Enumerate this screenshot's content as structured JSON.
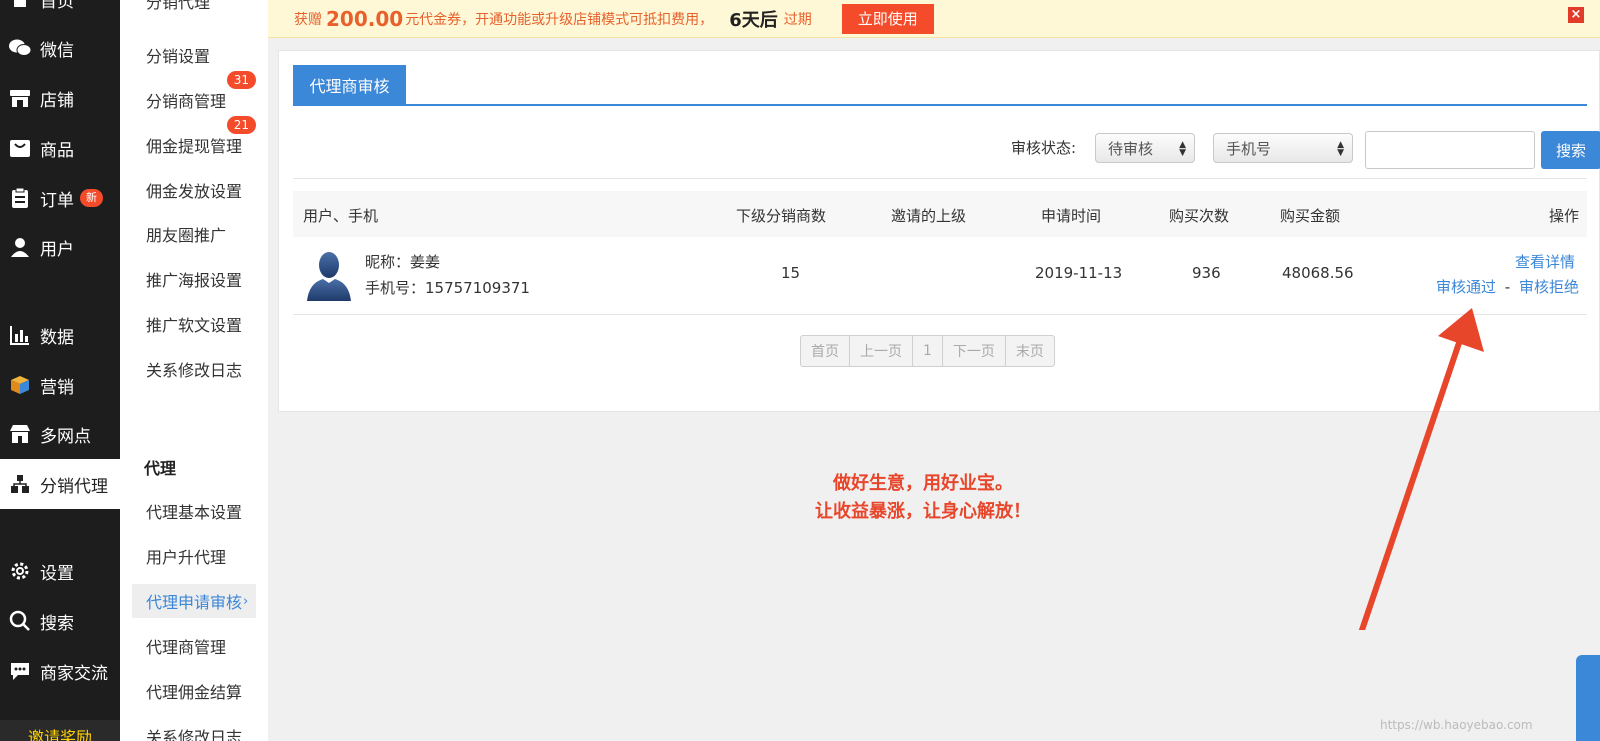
{
  "nav": {
    "items": [
      {
        "label": "首页",
        "icon": "home-icon"
      },
      {
        "label": "微信",
        "icon": "wechat-icon"
      },
      {
        "label": "店铺",
        "icon": "store-icon"
      },
      {
        "label": "商品",
        "icon": "bag-icon"
      },
      {
        "label": "订单",
        "icon": "clipboard-icon",
        "badge": "新"
      },
      {
        "label": "用户",
        "icon": "user-icon"
      },
      {
        "label": "数据",
        "icon": "chart-icon"
      },
      {
        "label": "营销",
        "icon": "cube-icon"
      },
      {
        "label": "多网点",
        "icon": "shop-icon"
      },
      {
        "label": "分销代理",
        "icon": "org-icon"
      },
      {
        "label": "设置",
        "icon": "gear-icon"
      },
      {
        "label": "搜索",
        "icon": "search-icon"
      },
      {
        "label": "商家交流",
        "icon": "chat-icon"
      }
    ],
    "invite": "邀请奖励"
  },
  "sub": {
    "top_partial": "分销代理",
    "items": [
      {
        "label": "分销设置"
      },
      {
        "label": "分销商管理",
        "badge": "31"
      },
      {
        "label": "佣金提现管理",
        "badge": "21"
      },
      {
        "label": "佣金发放设置"
      },
      {
        "label": "朋友圈推广"
      },
      {
        "label": "推广海报设置"
      },
      {
        "label": "推广软文设置"
      },
      {
        "label": "关系修改日志"
      }
    ],
    "heading": "代理",
    "items2": [
      {
        "label": "代理基本设置"
      },
      {
        "label": "用户升代理"
      },
      {
        "label": "代理申请审核"
      },
      {
        "label": "代理商管理"
      },
      {
        "label": "代理佣金结算"
      },
      {
        "label": "关系修改日志"
      }
    ]
  },
  "notice": {
    "prefix": "获赠",
    "amount": "200.00",
    "text": "元代金券，开通功能或升级店铺模式可抵扣费用，",
    "days": "6天后",
    "suffix": "过期",
    "button": "立即使用",
    "close": "×"
  },
  "tab": {
    "label": "代理商审核"
  },
  "filter": {
    "label": "审核状态:",
    "status_value": "待审核",
    "field_value": "手机号",
    "search_button": "搜索"
  },
  "table": {
    "headers": [
      "用户、手机",
      "下级分销商数",
      "邀请的上级",
      "申请时间",
      "购买次数",
      "购买金额",
      "操作"
    ],
    "rows": [
      {
        "nickname": "昵称：姜姜",
        "phone": "手机号：15757109371",
        "sub_count": "15",
        "inviter": "",
        "apply_time": "2019-11-13",
        "buy_count": "936",
        "buy_amount": "48068.56",
        "action_detail": "查看详情",
        "action_approve": "审核通过",
        "action_sep": "-",
        "action_reject": "审核拒绝"
      }
    ]
  },
  "pager": [
    "首页",
    "上一页",
    "1",
    "下一页",
    "末页"
  ],
  "slogan": {
    "line1": "做好生意，用好业宝。",
    "line2": "让收益暴涨，让身心解放！"
  },
  "colors": {
    "primary": "#3b87d8",
    "danger": "#f44b2a",
    "nav_bg": "#1d1d1d",
    "annotation": "#e8462b"
  },
  "watermark": "https://wb.haoyebao.com"
}
